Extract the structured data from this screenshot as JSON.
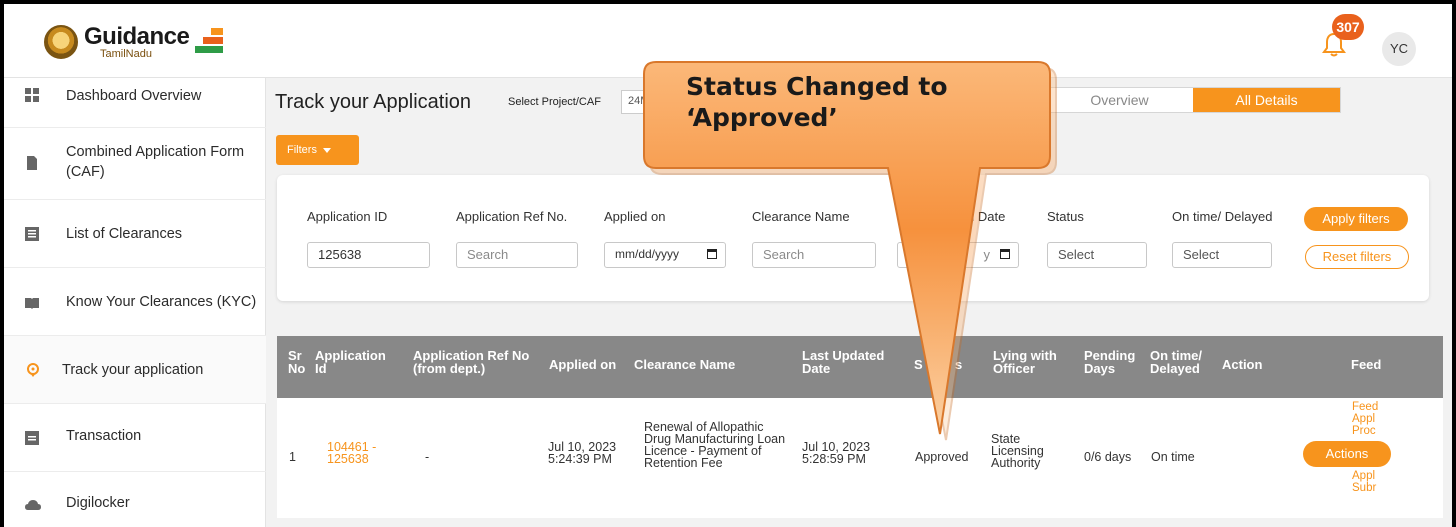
{
  "brand": {
    "name": "Guidance",
    "sub": "TamilNadu"
  },
  "header": {
    "notification_count": "307",
    "avatar_initials": "YC"
  },
  "sidebar": {
    "items": [
      {
        "label": "Dashboard Overview",
        "icon": "grid-icon"
      },
      {
        "label": "Combined Application Form (CAF)",
        "icon": "document-icon"
      },
      {
        "label": "List of Clearances",
        "icon": "list-icon"
      },
      {
        "label": "Know Your Clearances (KYC)",
        "icon": "book-icon"
      },
      {
        "label": "Track your application",
        "icon": "location-pin-icon",
        "active": true
      },
      {
        "label": "Transaction",
        "icon": "card-icon"
      },
      {
        "label": "Digilocker",
        "icon": "cloud-icon"
      }
    ]
  },
  "main": {
    "title": "Track your Application",
    "project_label": "Select Project/CAF",
    "project_value": "24M",
    "tabs": {
      "overview": "Overview",
      "all_details": "All Details"
    },
    "filters_label": "Filters"
  },
  "filters": {
    "fields": [
      {
        "label": "Application ID",
        "value": "125638"
      },
      {
        "label": "Application Ref No.",
        "placeholder": "Search"
      },
      {
        "label": "Applied on",
        "placeholder": "mm/dd/yyyy"
      },
      {
        "label": "Clearance Name",
        "placeholder": "Search"
      },
      {
        "label": "d Date",
        "placeholder": "y"
      },
      {
        "label": "Status",
        "placeholder": "Select"
      },
      {
        "label": "On time/ Delayed",
        "placeholder": "Select"
      }
    ],
    "apply_label": "Apply filters",
    "reset_label": "Reset filters"
  },
  "table": {
    "headers": {
      "sr": "Sr No",
      "app_id": "Application Id",
      "ref_no": "Application Ref No (from dept.)",
      "applied": "Applied on",
      "clearance": "Clearance Name",
      "updated": "Last Updated Date",
      "status": "S",
      "status_tail": "s",
      "officer": "Lying with Officer",
      "pending": "Pending Days",
      "ontime": "On time/ Delayed",
      "action": "Action",
      "feedback": "Feed"
    },
    "row": {
      "sr": "1",
      "app_id": "104461 - 125638",
      "ref_no": "-",
      "applied": "Jul 10, 2023 5:24:39 PM",
      "clearance": "Renewal of Allopathic Drug Manufacturing Loan Licence - Payment of Retention Fee",
      "updated": "Jul 10, 2023 5:28:59 PM",
      "status": "Approved",
      "officer": "State Licensing Authority",
      "pending": "0/6 days",
      "ontime": "On time",
      "action_label": "Actions",
      "feedback_1": "Feed Appl Proc",
      "feedback_2": "Feed Appl Subr"
    }
  },
  "callout": {
    "text": "Status Changed to ‘Approved’"
  },
  "colors": {
    "accent": "#f7941d",
    "header_bg": "#888888",
    "badge": "#e9611c"
  }
}
